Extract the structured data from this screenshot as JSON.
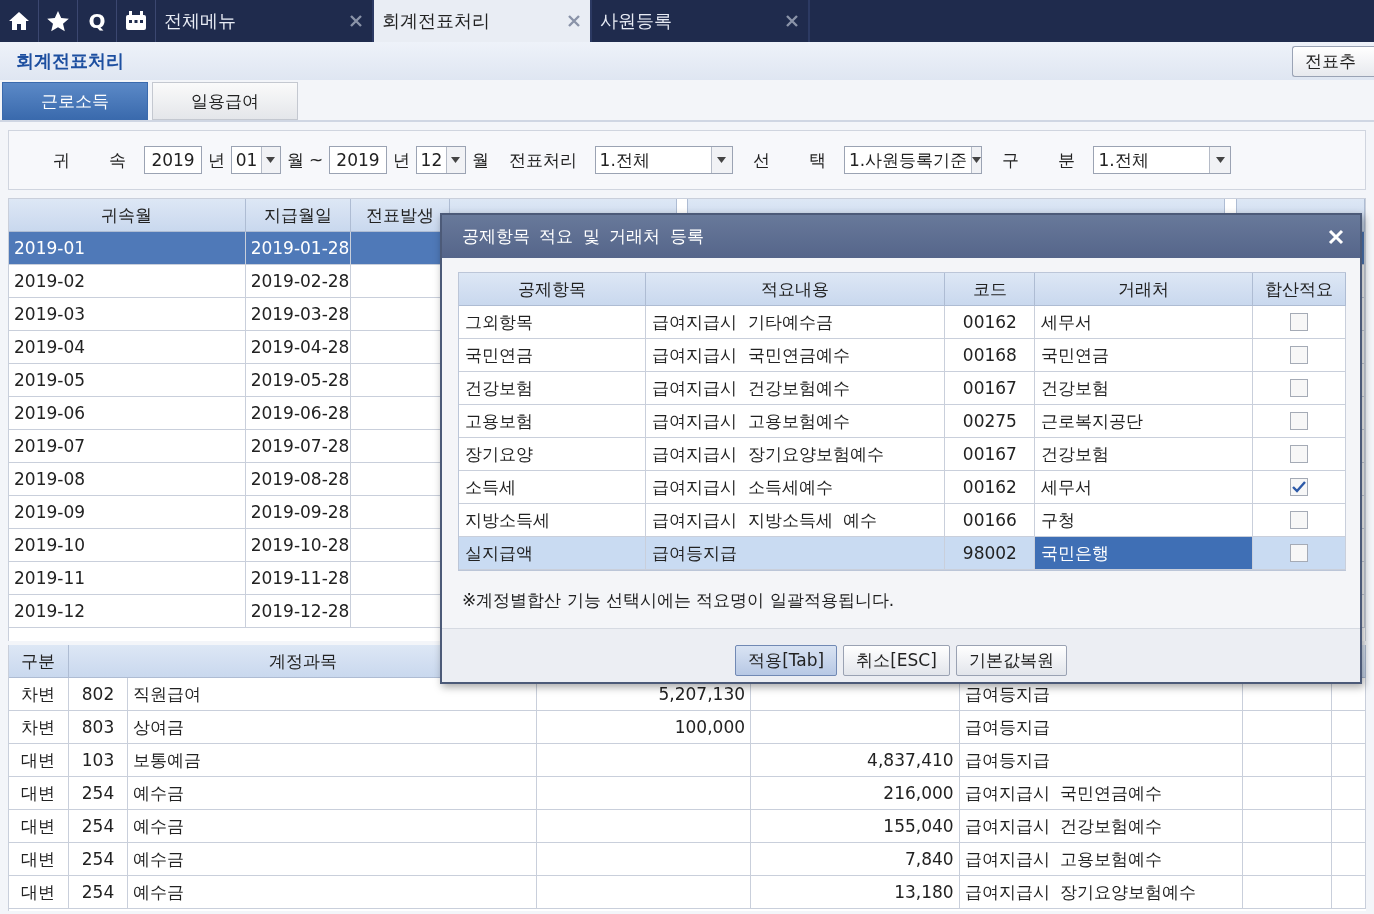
{
  "tabbar": {
    "search_glyph": "Q",
    "tabs": [
      {
        "label": "전체메뉴",
        "selected": false
      },
      {
        "label": "회계전표처리",
        "selected": true
      },
      {
        "label": "사원등록",
        "selected": false
      }
    ]
  },
  "header": {
    "title": "회계전표처리",
    "add_button": "전표추"
  },
  "subtabs": [
    {
      "label": "근로소득",
      "selected": true
    },
    {
      "label": "일용급여",
      "selected": false
    }
  ],
  "filters": [
    {
      "kind": "label",
      "text": "귀 속"
    },
    {
      "kind": "field",
      "value": "2019"
    },
    {
      "kind": "text",
      "text": "년"
    },
    {
      "kind": "select",
      "value": "01"
    },
    {
      "kind": "text",
      "text": "월 ~"
    },
    {
      "kind": "field",
      "value": "2019"
    },
    {
      "kind": "text",
      "text": "년"
    },
    {
      "kind": "select",
      "value": "12"
    },
    {
      "kind": "text",
      "text": "월"
    },
    {
      "kind": "label",
      "text": "전표처리"
    },
    {
      "kind": "select",
      "value": "1.전체",
      "wide": true
    },
    {
      "kind": "label",
      "text": "선 택"
    },
    {
      "kind": "select",
      "value": "1.사원등록기준",
      "wide": true
    },
    {
      "kind": "label",
      "text": "구 분"
    },
    {
      "kind": "select",
      "value": "1.전체",
      "wide": true
    }
  ],
  "month_table": {
    "columns": [
      "귀속월",
      "지급월일",
      "전표발생"
    ],
    "rows": [
      {
        "cells": [
          "2019-01",
          "2019-01-28"
        ],
        "selected": true
      },
      {
        "cells": [
          "2019-02",
          "2019-02-28"
        ],
        "selected": false
      },
      {
        "cells": [
          "2019-03",
          "2019-03-28"
        ],
        "selected": false
      },
      {
        "cells": [
          "2019-04",
          "2019-04-28"
        ],
        "selected": false
      },
      {
        "cells": [
          "2019-05",
          "2019-05-28"
        ],
        "selected": false
      },
      {
        "cells": [
          "2019-06",
          "2019-06-28"
        ],
        "selected": false
      },
      {
        "cells": [
          "2019-07",
          "2019-07-28"
        ],
        "selected": false
      },
      {
        "cells": [
          "2019-08",
          "2019-08-28"
        ],
        "selected": false
      },
      {
        "cells": [
          "2019-09",
          "2019-09-28"
        ],
        "selected": false
      },
      {
        "cells": [
          "2019-10",
          "2019-10-28"
        ],
        "selected": false
      },
      {
        "cells": [
          "2019-11",
          "2019-11-28"
        ],
        "selected": false
      },
      {
        "cells": [
          "2019-12",
          "2019-12-28"
        ],
        "selected": false
      }
    ]
  },
  "journal_table": {
    "columns": [
      "구분",
      "계정과목"
    ],
    "rows": [
      {
        "cells": [
          "차변",
          "802",
          "직원급여",
          "5,207,130",
          "",
          "급여등지급"
        ]
      },
      {
        "cells": [
          "차변",
          "803",
          "상여금",
          "100,000",
          "",
          "급여등지급"
        ]
      },
      {
        "cells": [
          "대변",
          "103",
          "보통예금",
          "",
          "4,837,410",
          "급여등지급"
        ]
      },
      {
        "cells": [
          "대변",
          "254",
          "예수금",
          "",
          "216,000",
          "급여지급시  국민연금예수"
        ]
      },
      {
        "cells": [
          "대변",
          "254",
          "예수금",
          "",
          "155,040",
          "급여지급시  건강보험예수"
        ]
      },
      {
        "cells": [
          "대변",
          "254",
          "예수금",
          "",
          "7,840",
          "급여지급시  고용보험예수"
        ]
      },
      {
        "cells": [
          "대변",
          "254",
          "예수금",
          "",
          "13,180",
          "급여지급시  장기요양보험예수"
        ]
      }
    ]
  },
  "dialog": {
    "title": "공제항목 적요 및 거래처 등록",
    "columns": [
      "공제항목",
      "적요내용",
      "코드",
      "거래처",
      "합산적요"
    ],
    "rows": [
      {
        "cells": [
          "그외항목",
          "급여지급시  기타예수금",
          "00162",
          "세무서"
        ],
        "checked": false,
        "selected": false
      },
      {
        "cells": [
          "국민연금",
          "급여지급시  국민연금예수",
          "00168",
          "국민연금"
        ],
        "checked": false,
        "selected": false
      },
      {
        "cells": [
          "건강보험",
          "급여지급시  건강보험예수",
          "00167",
          "건강보험"
        ],
        "checked": false,
        "selected": false
      },
      {
        "cells": [
          "고용보험",
          "급여지급시  고용보험예수",
          "00275",
          "근로복지공단"
        ],
        "checked": false,
        "selected": false
      },
      {
        "cells": [
          "장기요양",
          "급여지급시  장기요양보험예수",
          "00167",
          "건강보험"
        ],
        "checked": false,
        "selected": false
      },
      {
        "cells": [
          "소득세",
          "급여지급시  소득세예수",
          "00162",
          "세무서"
        ],
        "checked": true,
        "selected": false
      },
      {
        "cells": [
          "지방소득세",
          "급여지급시  지방소득세  예수",
          "00166",
          "구청"
        ],
        "checked": false,
        "selected": false
      },
      {
        "cells": [
          "실지급액",
          "급여등지급",
          "98002",
          "국민은행"
        ],
        "checked": false,
        "selected": true
      }
    ],
    "note": "※계정별합산 기능 선택시에는 적요명이 일괄적용됩니다.",
    "buttons": [
      {
        "label": "적용[Tab]",
        "focused": true
      },
      {
        "label": "취소[ESC]",
        "focused": false
      },
      {
        "label": "기본값복원",
        "focused": false
      }
    ]
  }
}
